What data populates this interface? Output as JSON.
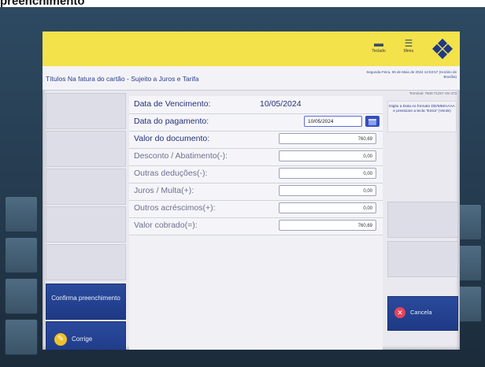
{
  "caption": "preenchimento",
  "header": {
    "teclado_label": "Teclado",
    "menu_label": "Menu"
  },
  "subheader": {
    "title": "Títulos Na fatura do cartão - Sujeito a Juros e Tarifa",
    "datetime": "Segunda-Feira, 06 de Maio de 2024 14:53:57 (Horário de Brasília)",
    "terminal": "Terminal: 7600-71257 Ver.473"
  },
  "form": {
    "vencimento_label": "Data de Vencimento:",
    "vencimento_value": "10/05/2024",
    "pagamento_label": "Data do pagamento:",
    "pagamento_value": "10/05/2024",
    "valor_documento_label": "Valor do documento:",
    "valor_documento_value": "760,69",
    "desconto_label": "Desconto / Abatimento(-):",
    "desconto_value": "0,00",
    "outras_deducoes_label": "Outras deduções(-):",
    "outras_deducoes_value": "0,00",
    "juros_label": "Juros / Multa(+):",
    "juros_value": "0,00",
    "outros_acrescimos_label": "Outros acréscimos(+):",
    "outros_acrescimos_value": "0,00",
    "valor_cobrado_label": "Valor cobrado(=):",
    "valor_cobrado_value": "760,69"
  },
  "hint": "Digite a Data no formato DD/MM/AAAA e pressione a tecla \"Entra\" (Verde)",
  "buttons": {
    "confirma": "Confirma preenchimento",
    "corrige": "Corrige",
    "cancela": "Cancela"
  },
  "colors": {
    "topbar": "#f4e24a",
    "primary_blue": "#1e3a86",
    "label_blue": "#25307a",
    "cancel_red": "#e6435a",
    "corrige_yellow": "#f0c02a"
  }
}
